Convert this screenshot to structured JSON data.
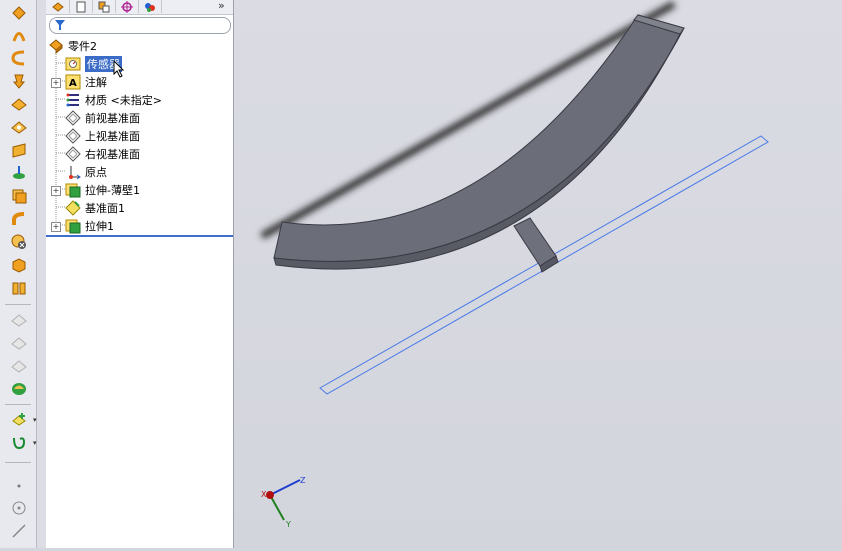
{
  "feature_tree": {
    "root": "零件2",
    "items": [
      {
        "label": "传感器",
        "selected": true
      },
      {
        "label": "注解"
      },
      {
        "label": "材质 <未指定>"
      },
      {
        "label": "前视基准面"
      },
      {
        "label": "上视基准面"
      },
      {
        "label": "右视基准面"
      },
      {
        "label": "原点"
      },
      {
        "label": "拉伸-薄壁1"
      },
      {
        "label": "基准面1"
      },
      {
        "label": "拉伸1"
      }
    ]
  },
  "triad": {
    "x": "X",
    "y": "Y",
    "z": "Z"
  },
  "colors": {
    "selection": "#3a6cc7",
    "model": "#6b6d78",
    "plane_outline": "#4a7ae8"
  }
}
